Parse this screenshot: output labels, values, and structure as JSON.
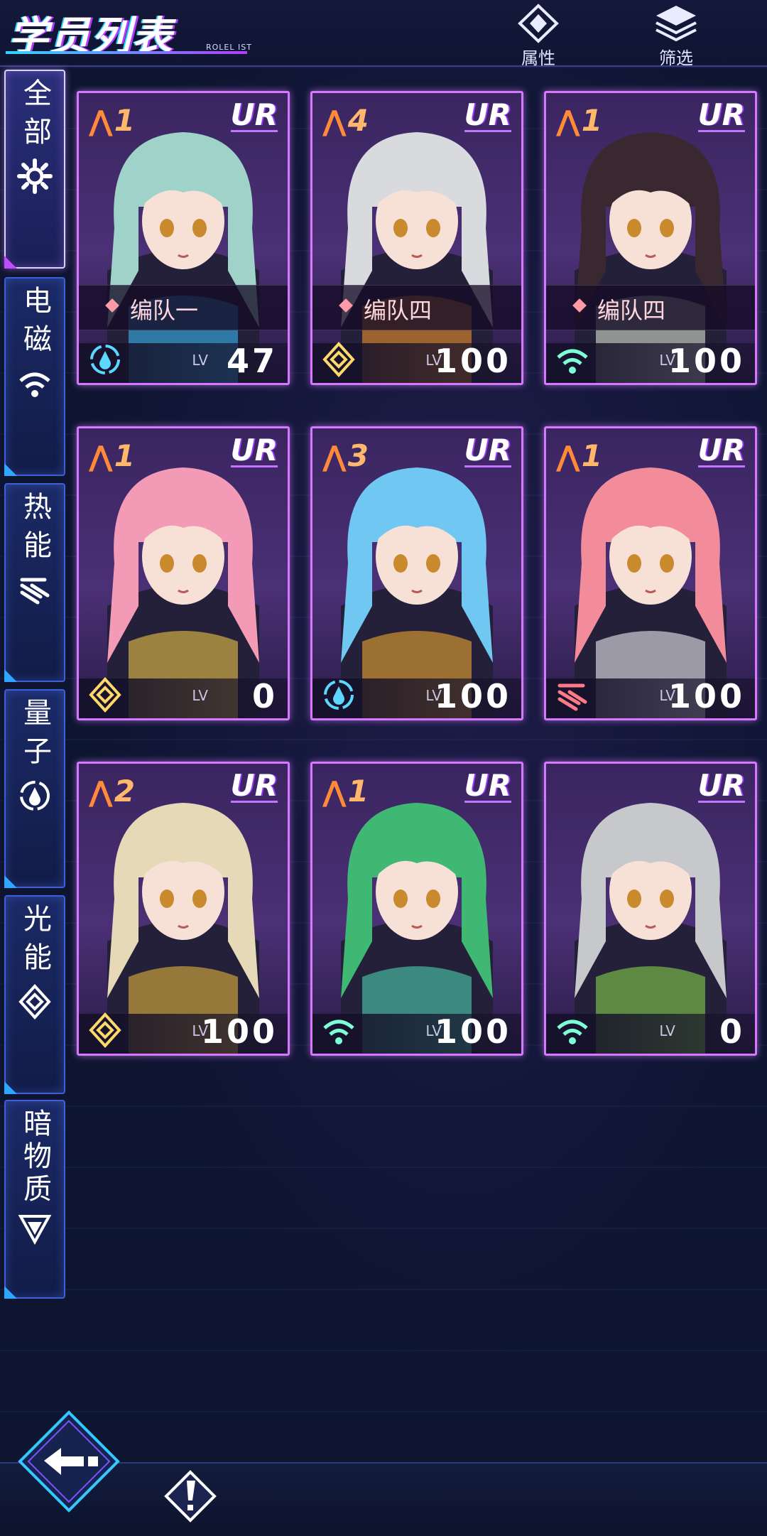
{
  "header": {
    "title": "学员列表",
    "subtitle": "ROLEL IST",
    "attribute_label": "属性",
    "filter_label": "筛选"
  },
  "tabs": [
    {
      "label": "全部",
      "icon": "all-elements-icon",
      "active": true
    },
    {
      "label": "电磁",
      "icon": "electromagnetic-icon",
      "active": false
    },
    {
      "label": "热能",
      "icon": "thermal-icon",
      "active": false
    },
    {
      "label": "量子",
      "icon": "quantum-icon",
      "active": false
    },
    {
      "label": "光能",
      "icon": "light-icon",
      "active": false
    },
    {
      "label": "暗物质",
      "icon": "dark-matter-icon",
      "active": false
    }
  ],
  "cards": [
    {
      "stars": "1",
      "rarity": "UR",
      "team": "编队一",
      "element": "quantum",
      "lv_tag": "LV",
      "level": "47",
      "hair": "#9fd3c9",
      "accent": "#39c2ff"
    },
    {
      "stars": "4",
      "rarity": "UR",
      "team": "编队四",
      "element": "light",
      "lv_tag": "LV",
      "level": "100",
      "hair": "#d9dade",
      "accent": "#ff9a2a"
    },
    {
      "stars": "1",
      "rarity": "UR",
      "team": "编队四",
      "element": "electromagnetic",
      "lv_tag": "LV",
      "level": "100",
      "hair": "#3a2830",
      "accent": "#e8f2d8"
    },
    {
      "stars": "1",
      "rarity": "UR",
      "team": "",
      "element": "light",
      "lv_tag": "LV",
      "level": "0",
      "hair": "#f39ab6",
      "accent": "#ffd447"
    },
    {
      "stars": "3",
      "rarity": "UR",
      "team": "",
      "element": "quantum",
      "lv_tag": "LV",
      "level": "100",
      "hair": "#6fc7f2",
      "accent": "#ffb02e"
    },
    {
      "stars": "1",
      "rarity": "UR",
      "team": "",
      "element": "thermal",
      "lv_tag": "LV",
      "level": "100",
      "hair": "#f28b9a",
      "accent": "#ffffff"
    },
    {
      "stars": "2",
      "rarity": "UR",
      "team": "",
      "element": "light",
      "lv_tag": "LV",
      "level": "100",
      "hair": "#e6d9b8",
      "accent": "#f4c23a"
    },
    {
      "stars": "1",
      "rarity": "UR",
      "team": "",
      "element": "electromagnetic",
      "lv_tag": "LV",
      "level": "100",
      "hair": "#3fb874",
      "accent": "#4fe0b8"
    },
    {
      "stars": "",
      "rarity": "UR",
      "team": "",
      "element": "electromagnetic",
      "lv_tag": "LV",
      "level": "0",
      "hair": "#c7c8cc",
      "accent": "#8ee04a"
    }
  ],
  "footer": {
    "back_icon": "back-arrow-icon",
    "tip_icon": "exclamation-icon"
  }
}
